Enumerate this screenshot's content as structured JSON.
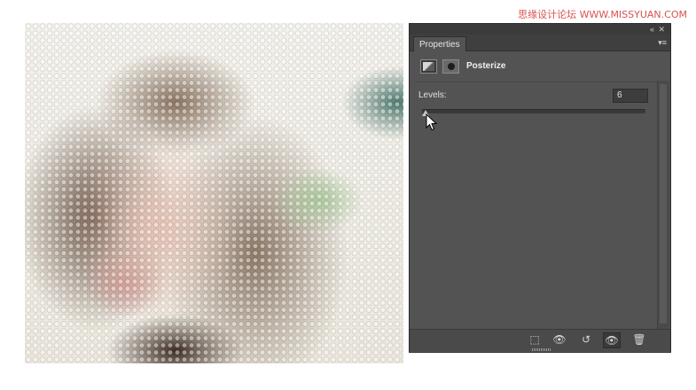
{
  "watermark": "思缘设计论坛 WWW.MISSYUAN.COM",
  "panel": {
    "tab_label": "Properties",
    "adjustment_title": "Posterize",
    "levels_label": "Levels:",
    "levels_value": "6",
    "levels_slider_fraction": 0.0
  },
  "icons": {
    "collapse": "«",
    "close": "✕",
    "panel_menu": "▾≡",
    "clip": "⬚",
    "previous_state": "👁",
    "reset": "↺",
    "visibility": "👁",
    "delete": "🗑"
  }
}
